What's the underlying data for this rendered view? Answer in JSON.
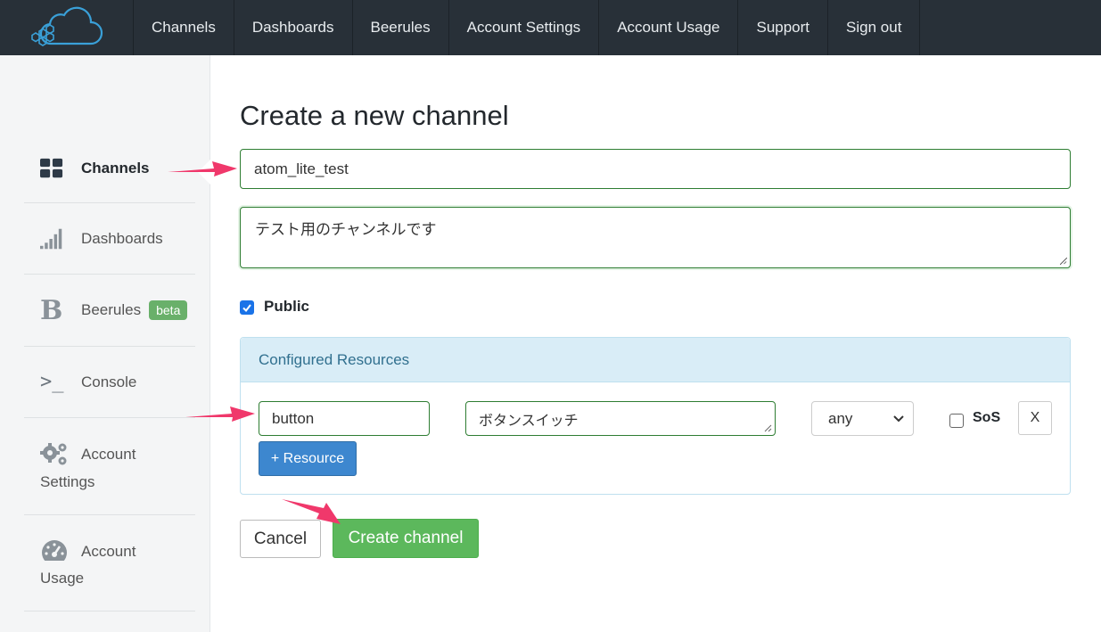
{
  "nav": {
    "items": [
      "Channels",
      "Dashboards",
      "Beerules",
      "Account Settings",
      "Account Usage",
      "Support",
      "Sign out"
    ]
  },
  "sidebar": {
    "channels": "Channels",
    "dashboards": "Dashboards",
    "beerules": "Beerules",
    "beta": "beta",
    "console": "Console",
    "console_icon": ">_",
    "beerules_icon": "B",
    "settings_l1": "Account",
    "settings_l2": "Settings",
    "usage_l1": "Account",
    "usage_l2": "Usage"
  },
  "form": {
    "title": "Create a new channel",
    "name_value": "atom_lite_test",
    "description_value": "テスト用のチャンネルです",
    "public_label": "Public",
    "public_checked": true
  },
  "resources": {
    "header": "Configured Resources",
    "row": {
      "key": "button",
      "description": "ボタンスイッチ",
      "type": "any",
      "sos_label": "SoS",
      "sos_checked": false,
      "remove_label": "X"
    },
    "add_label": "+ Resource"
  },
  "actions": {
    "cancel": "Cancel",
    "create": "Create channel"
  },
  "colors": {
    "nav_bg": "#283038",
    "accent_green": "#5cb85c",
    "accent_blue": "#3d87cf",
    "annotation_arrow": "#f0386b"
  }
}
